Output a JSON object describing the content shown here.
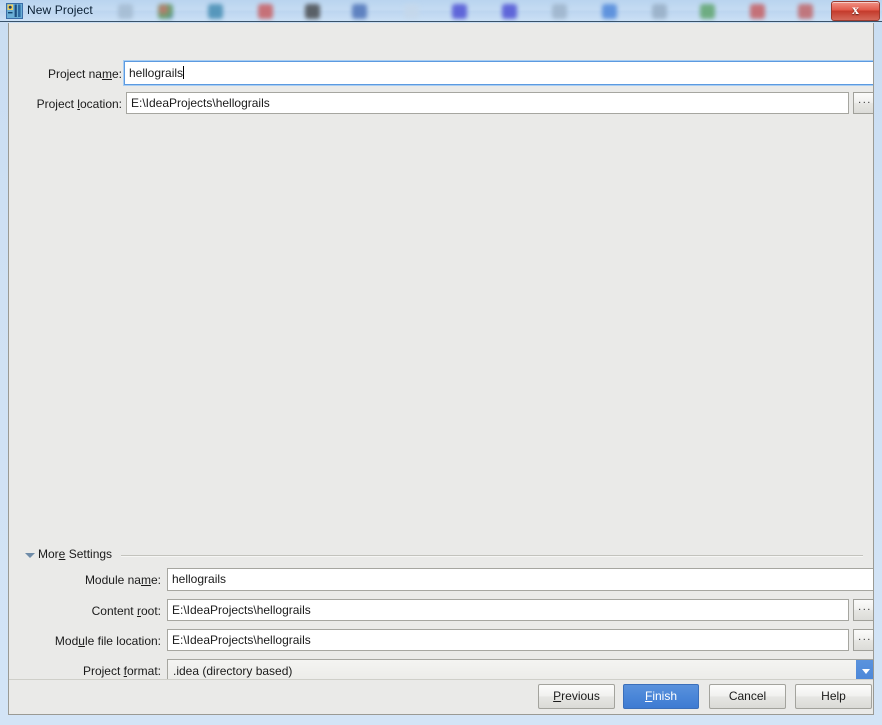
{
  "window": {
    "title": "New Project",
    "app_icon": "intellij-idea-icon",
    "close_label": "x",
    "accent_blue": "#4a86d8",
    "frame_blue": "#cfe1f4",
    "panel_bg": "#eaeae8"
  },
  "form": {
    "project_name": {
      "label_pre": "Project na",
      "label_mnemonic": "m",
      "label_post": "e:",
      "value": "hellograils",
      "focused": true
    },
    "project_location": {
      "label_pre": "Project ",
      "label_mnemonic": "l",
      "label_post": "ocation:",
      "value": "E:\\IdeaProjects\\hellograils",
      "browse_label": "..."
    }
  },
  "more_settings": {
    "label_pre": "Mor",
    "label_mnemonic": "e",
    "label_post": " Settings",
    "expanded": true,
    "fields": {
      "module_name": {
        "label_pre": "Module na",
        "label_mnemonic": "m",
        "label_post": "e:",
        "value": "hellograils"
      },
      "content_root": {
        "label_pre": "Content ",
        "label_mnemonic": "r",
        "label_post": "oot:",
        "value": "E:\\IdeaProjects\\hellograils",
        "browse_label": "..."
      },
      "module_file_location": {
        "label_pre": "Mod",
        "label_mnemonic": "u",
        "label_post": "le file location:",
        "value": "E:\\IdeaProjects\\hellograils",
        "browse_label": "..."
      },
      "project_format": {
        "label_pre": "Project ",
        "label_mnemonic": "f",
        "label_post": "ormat:",
        "value": ".idea (directory based)"
      }
    }
  },
  "buttons": {
    "previous": {
      "pre": "",
      "mnemonic": "P",
      "post": "revious"
    },
    "finish": {
      "pre": "",
      "mnemonic": "F",
      "post": "inish",
      "default": true
    },
    "cancel": {
      "pre": "Cancel",
      "mnemonic": "",
      "post": ""
    },
    "help": {
      "pre": "Help",
      "mnemonic": "",
      "post": ""
    }
  }
}
